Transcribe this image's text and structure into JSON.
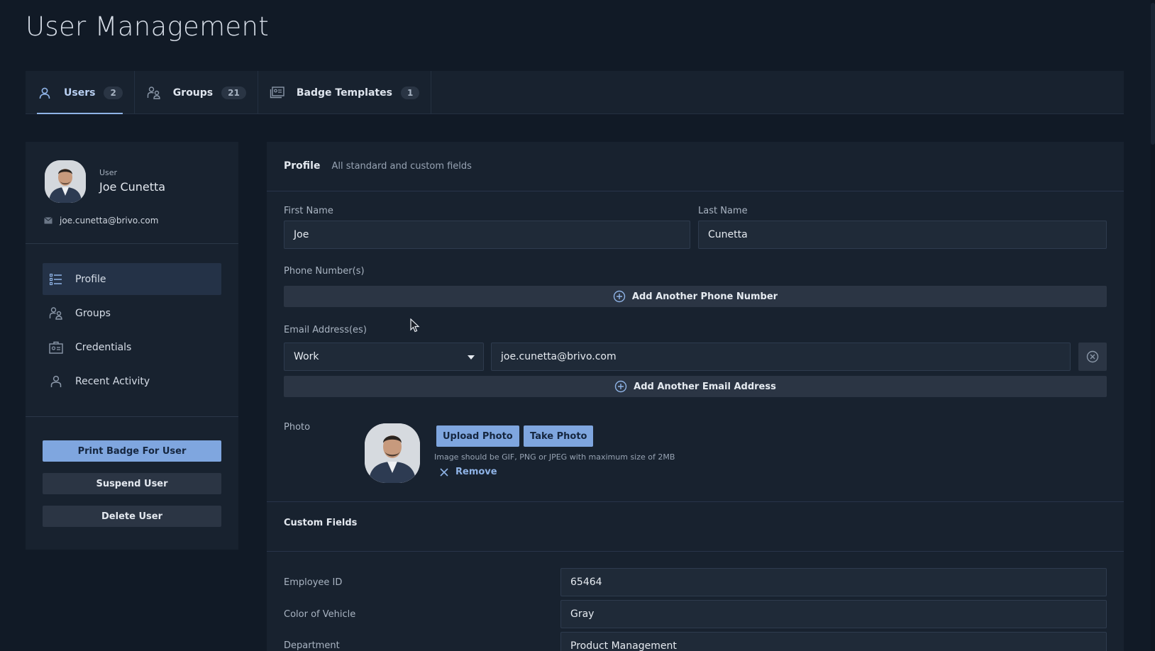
{
  "page": {
    "title": "User Management"
  },
  "tabs": [
    {
      "label": "Users",
      "count": "2",
      "icon": "user-icon"
    },
    {
      "label": "Groups",
      "count": "21",
      "icon": "groups-icon"
    },
    {
      "label": "Badge Templates",
      "count": "1",
      "icon": "badge-templates-icon"
    }
  ],
  "user": {
    "caption": "User",
    "name": "Joe Cunetta",
    "email": "joe.cunetta@brivo.com"
  },
  "nav": {
    "items": [
      {
        "label": "Profile",
        "icon": "list-icon"
      },
      {
        "label": "Groups",
        "icon": "groups-icon"
      },
      {
        "label": "Credentials",
        "icon": "credentials-icon"
      },
      {
        "label": "Recent Activity",
        "icon": "person-icon"
      }
    ]
  },
  "actions": {
    "print_badge": "Print Badge For User",
    "suspend": "Suspend User",
    "delete": "Delete User"
  },
  "profile": {
    "title": "Profile",
    "subtitle": "All standard and custom fields",
    "first_name_label": "First Name",
    "first_name_value": "Joe",
    "last_name_label": "Last Name",
    "last_name_value": "Cunetta",
    "phone_label": "Phone Number(s)",
    "add_phone": "Add Another Phone Number",
    "email_label": "Email Address(es)",
    "email_type": "Work",
    "email_value": "joe.cunetta@brivo.com",
    "add_email": "Add Another Email Address",
    "photo_label": "Photo",
    "upload_photo": "Upload Photo",
    "take_photo": "Take Photo",
    "photo_hint": "Image should be GIF, PNG or JPEG with maximum size of 2MB",
    "remove": "Remove"
  },
  "custom_fields": {
    "title": "Custom Fields",
    "fields": [
      {
        "label": "Employee ID",
        "value": "65464"
      },
      {
        "label": "Color of Vehicle",
        "value": "Gray"
      },
      {
        "label": "Department",
        "value": "Product Management"
      }
    ]
  }
}
